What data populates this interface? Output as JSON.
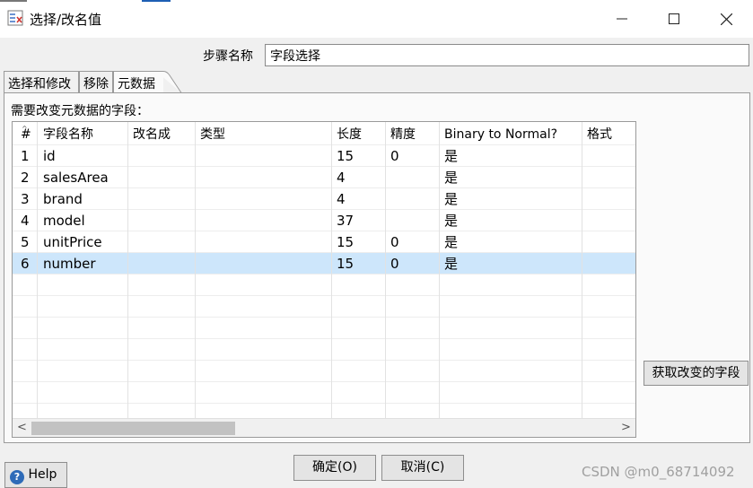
{
  "window": {
    "title": "选择/改名值",
    "icon": "select-rename-icon",
    "controls": [
      "minimize-icon",
      "maximize-icon",
      "close-icon"
    ]
  },
  "step": {
    "label": "步骤名称",
    "value": "字段选择"
  },
  "tabs": [
    {
      "label": "选择和修改",
      "active": false
    },
    {
      "label": "移除",
      "active": false
    },
    {
      "label": "元数据",
      "active": true
    }
  ],
  "panel": {
    "label": "需要改变元数据的字段："
  },
  "table": {
    "columns": [
      "#",
      "字段名称",
      "改名成",
      "类型",
      "长度",
      "精度",
      "Binary to Normal?",
      "格式"
    ],
    "rows": [
      [
        "1",
        "id",
        "",
        "",
        "15",
        "0",
        "是",
        ""
      ],
      [
        "2",
        "salesArea",
        "",
        "",
        "4",
        "",
        "是",
        ""
      ],
      [
        "3",
        "brand",
        "",
        "",
        "4",
        "",
        "是",
        ""
      ],
      [
        "4",
        "model",
        "",
        "",
        "37",
        "",
        "是",
        ""
      ],
      [
        "5",
        "unitPrice",
        "",
        "",
        "15",
        "0",
        "是",
        ""
      ],
      [
        "6",
        "number",
        "",
        "",
        "15",
        "0",
        "是",
        ""
      ]
    ],
    "selected_row": 6,
    "scroll_left": "<",
    "scroll_right": ">"
  },
  "buttons": {
    "get_changed_fields": "获取改变的字段",
    "ok": "确定(O)",
    "cancel": "取消(C)",
    "help": "Help"
  },
  "watermark": "CSDN @m0_68714092",
  "colors": {
    "selected_row": "#cde6fb",
    "window_bg": "#f0f0f0"
  }
}
